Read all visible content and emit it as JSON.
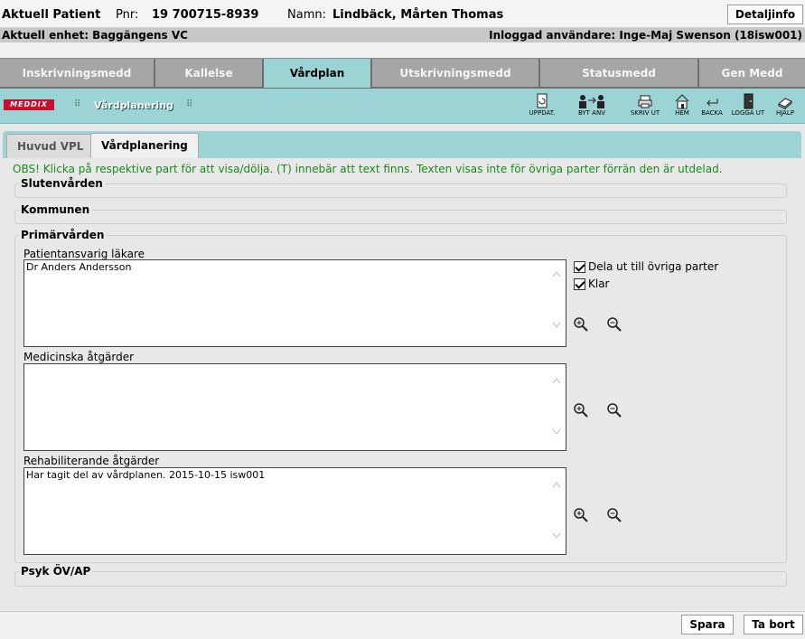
{
  "patient": {
    "label": "Aktuell Patient",
    "pnr_label": "Pnr:",
    "pnr": "19 700715-8939",
    "name_label": "Namn:",
    "name": "Lindbäck, Mårten Thomas",
    "detail_button": "Detaljinfo"
  },
  "unit": {
    "current_unit": "Aktuell enhet: Baggängens VC",
    "logged_in": "Inloggad användare: Inge-Maj Swenson (18isw001)"
  },
  "main_tabs": [
    {
      "label": "Inskrivningsmedd"
    },
    {
      "label": "Kallelse"
    },
    {
      "label": "Vårdplan"
    },
    {
      "label": "Utskrivningsmedd"
    },
    {
      "label": "Statusmedd"
    },
    {
      "label": "Gen Medd"
    }
  ],
  "active_main_tab": "Vårdplan",
  "toolbar": {
    "logo": "MEDDIX",
    "title": "Vårdplanering",
    "buttons": [
      {
        "label": "UPPDAT.",
        "icon": "refresh-icon"
      },
      {
        "label": "BYT ANV",
        "icon": "switch-user-icon"
      },
      {
        "label": "SKRIV UT",
        "icon": "printer-icon"
      },
      {
        "label": "HEM",
        "icon": "home-icon"
      },
      {
        "label": "BACKA",
        "icon": "back-icon"
      },
      {
        "label": "LOGGA UT",
        "icon": "logout-icon"
      },
      {
        "label": "HJÄLP",
        "icon": "help-icon"
      }
    ]
  },
  "sub_tabs": [
    {
      "label": "Huvud VPL"
    },
    {
      "label": "Vårdplanering"
    }
  ],
  "notice": "OBS! Klicka på respektive part för att visa/dölja. (T) innebär att text finns. Texten visas inte för övriga parter förrän den är utdelad.",
  "sections": {
    "slutenvarden": "Slutenvården",
    "kommunen": "Kommunen",
    "primarvarden": "Primärvården",
    "psyk": "Psyk ÖV/AP"
  },
  "primarvarden": {
    "fields": [
      {
        "label": "Patientansvarig läkare",
        "value": "Dr Anders Andersson"
      },
      {
        "label": "Medicinska åtgärder",
        "value": ""
      },
      {
        "label": "Rehabiliterande åtgärder",
        "value": "Har tagit del av vårdplanen. 2015-10-15 isw001"
      }
    ],
    "checkboxes": [
      {
        "label": "Dela ut till övriga parter",
        "checked": true
      },
      {
        "label": "Klar",
        "checked": true
      }
    ]
  },
  "actions": {
    "save": "Spara",
    "delete": "Ta bort"
  },
  "colors": {
    "accent": "#9cd3d5",
    "tab_bar": "#a6a6a6",
    "notice": "#1a8a1a",
    "logo": "#c8102e"
  }
}
